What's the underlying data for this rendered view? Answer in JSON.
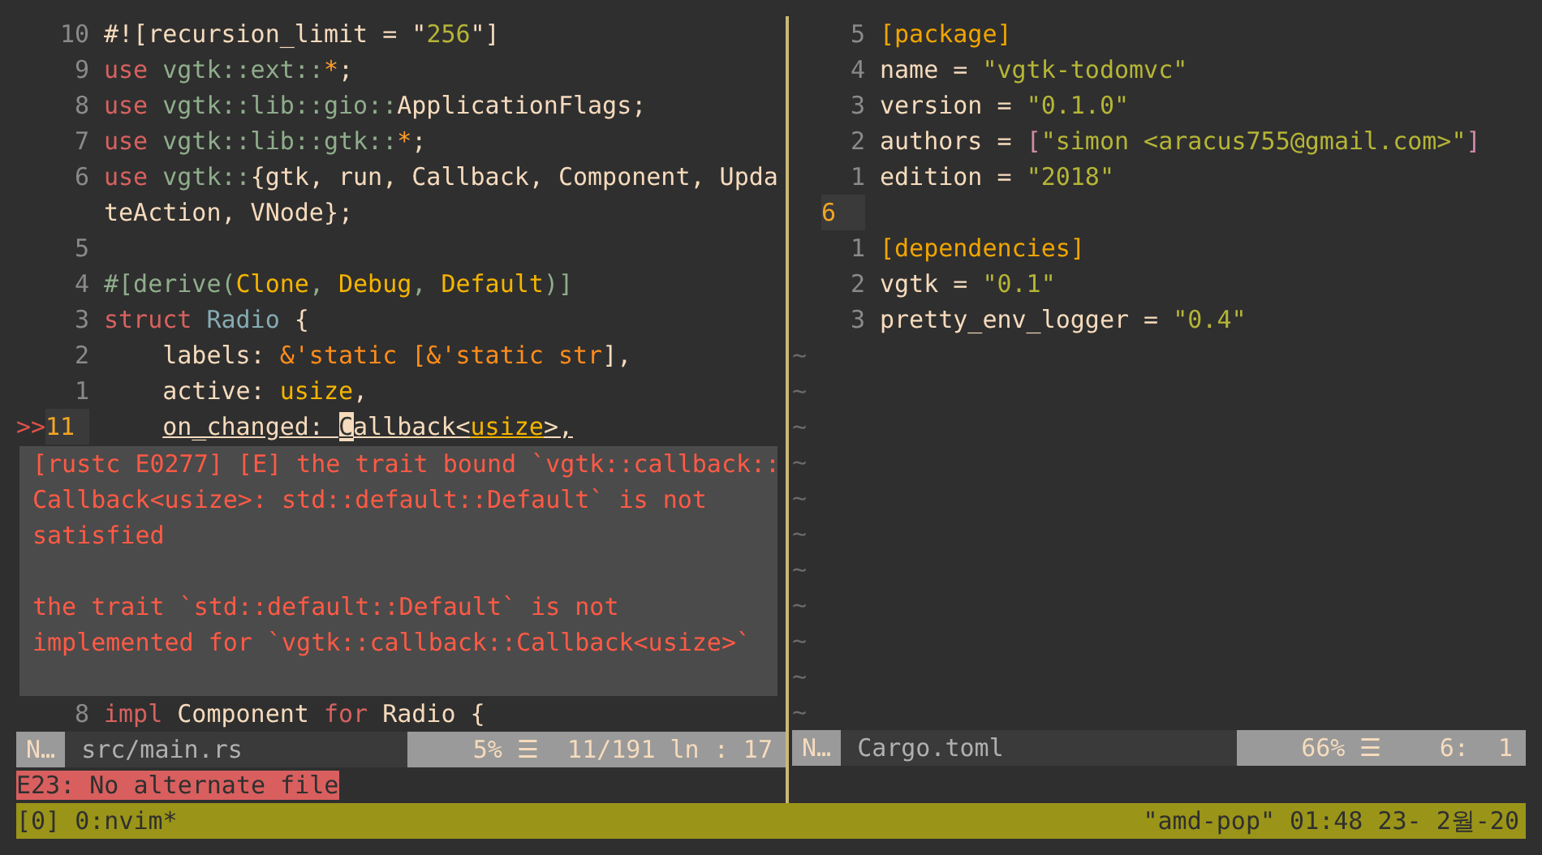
{
  "panes": [
    {
      "lines": [
        {
          "num": "10",
          "tokens": [
            {
              "text": "#![recursion_limit = \"",
              "kind": "text"
            },
            {
              "text": "256",
              "kind": "string"
            },
            {
              "text": "\"]",
              "kind": "text"
            }
          ]
        },
        {
          "num": "9",
          "tokens": [
            {
              "text": "use",
              "kind": "keyword"
            },
            {
              "text": " vgtk::ext::",
              "kind": "path"
            },
            {
              "text": "*",
              "kind": "glob"
            },
            {
              "text": ";",
              "kind": "text"
            }
          ]
        },
        {
          "num": "8",
          "tokens": [
            {
              "text": "use",
              "kind": "keyword"
            },
            {
              "text": " vgtk::lib::gio::",
              "kind": "path"
            },
            {
              "text": "ApplicationFlags;",
              "kind": "text"
            }
          ]
        },
        {
          "num": "7",
          "tokens": [
            {
              "text": "use",
              "kind": "keyword"
            },
            {
              "text": " vgtk::lib::gtk::",
              "kind": "path"
            },
            {
              "text": "*",
              "kind": "glob"
            },
            {
              "text": ";",
              "kind": "text"
            }
          ]
        },
        {
          "num": "6",
          "tokens": [
            {
              "text": "use",
              "kind": "keyword"
            },
            {
              "text": " vgtk::",
              "kind": "path"
            },
            {
              "text": "{gtk, run, Callback, Component, Upda",
              "kind": "text"
            }
          ]
        },
        {
          "tokens": [
            {
              "text": "teAction, VNode};",
              "kind": "text"
            }
          ]
        },
        {
          "num": "5"
        },
        {
          "num": "4",
          "tokens": [
            {
              "text": "#[derive(",
              "kind": "path"
            },
            {
              "text": "Clone",
              "kind": "type"
            },
            {
              "text": ", ",
              "kind": "path"
            },
            {
              "text": "Debug",
              "kind": "type"
            },
            {
              "text": ", ",
              "kind": "path"
            },
            {
              "text": "Default",
              "kind": "type"
            },
            {
              "text": ")]",
              "kind": "path"
            }
          ]
        },
        {
          "num": "3",
          "tokens": [
            {
              "text": "struct ",
              "kind": "keyword"
            },
            {
              "text": "Radio",
              "kind": "name"
            },
            {
              "text": " {",
              "kind": "text"
            }
          ]
        },
        {
          "num": "2",
          "tokens": [
            {
              "text": "    labels: ",
              "kind": "text"
            },
            {
              "text": "&'static [&'static str",
              "kind": "lifetime"
            },
            {
              "text": "],",
              "kind": "text"
            }
          ]
        },
        {
          "num": "1",
          "tokens": [
            {
              "text": "    active: ",
              "kind": "text"
            },
            {
              "text": "usize",
              "kind": "type"
            },
            {
              "text": ",",
              "kind": "text"
            }
          ]
        },
        {
          "num": "11",
          "current": true,
          "sign": ">>",
          "tokens": [
            {
              "text": "    on_changed: ",
              "kind": "text"
            },
            {
              "text": "C",
              "kind": "cursor"
            },
            {
              "text": "allback<",
              "kind": "text"
            },
            {
              "text": "usize",
              "kind": "type"
            },
            {
              "text": ">,",
              "kind": "text"
            }
          ]
        }
      ],
      "popup": [
        [
          "[rustc E0277] [E] the trait bound `vgtk::callback::",
          "Callback<usize>: std::default::Default` is not",
          "satisfied"
        ],
        [
          "the trait `std::default::Default` is not",
          "implemented for `vgtk::callback::Callback<usize>`"
        ]
      ],
      "after_lines": [
        {
          "num": "8",
          "tokens": [
            {
              "text": "impl",
              "kind": "keyword"
            },
            {
              "text": " Component ",
              "kind": "text"
            },
            {
              "text": "for",
              "kind": "keyword"
            },
            {
              "text": " Radio {",
              "kind": "text"
            }
          ]
        }
      ],
      "status": {
        "mode": "N…",
        "file": "src/main.rs",
        "position": "5% ☰  11/191 ln : 17"
      }
    },
    {
      "lines": [
        {
          "num": "5",
          "tokens": [
            {
              "text": "[package]",
              "kind": "section"
            }
          ]
        },
        {
          "num": "4",
          "tokens": [
            {
              "text": "name = ",
              "kind": "text"
            },
            {
              "text": "\"vgtk-todomvc\"",
              "kind": "string"
            }
          ]
        },
        {
          "num": "3",
          "tokens": [
            {
              "text": "version = ",
              "kind": "text"
            },
            {
              "text": "\"0.1.0\"",
              "kind": "string"
            }
          ]
        },
        {
          "num": "2",
          "tokens": [
            {
              "text": "authors = ",
              "kind": "text"
            },
            {
              "text": "[",
              "kind": "bracket"
            },
            {
              "text": "\"simon <aracus755@gmail.com>\"",
              "kind": "string"
            },
            {
              "text": "]",
              "kind": "bracket"
            }
          ]
        },
        {
          "num": "1",
          "tokens": [
            {
              "text": "edition = ",
              "kind": "text"
            },
            {
              "text": "\"2018\"",
              "kind": "string"
            }
          ]
        },
        {
          "num": "6",
          "current": true
        },
        {
          "num": "1",
          "tokens": [
            {
              "text": "[dependencies]",
              "kind": "section"
            }
          ]
        },
        {
          "num": "2",
          "tokens": [
            {
              "text": "vgtk = ",
              "kind": "text"
            },
            {
              "text": "\"0.1\"",
              "kind": "string"
            }
          ]
        },
        {
          "num": "3",
          "tokens": [
            {
              "text": "pretty_env_logger = ",
              "kind": "text"
            },
            {
              "text": "\"0.4\"",
              "kind": "string"
            }
          ]
        }
      ],
      "empty_lines": [
        "~",
        "~",
        "~",
        "~",
        "~",
        "~",
        "~",
        "~",
        "~",
        "~",
        "~"
      ],
      "status": {
        "mode": "N…",
        "file": "Cargo.toml",
        "position": "66% ☰    6:  1"
      }
    }
  ],
  "message": "E23: No alternate file",
  "tmux": {
    "window": "[0] 0:nvim*",
    "right": "\"amd-pop\" 01:48 23- 2월-20"
  }
}
